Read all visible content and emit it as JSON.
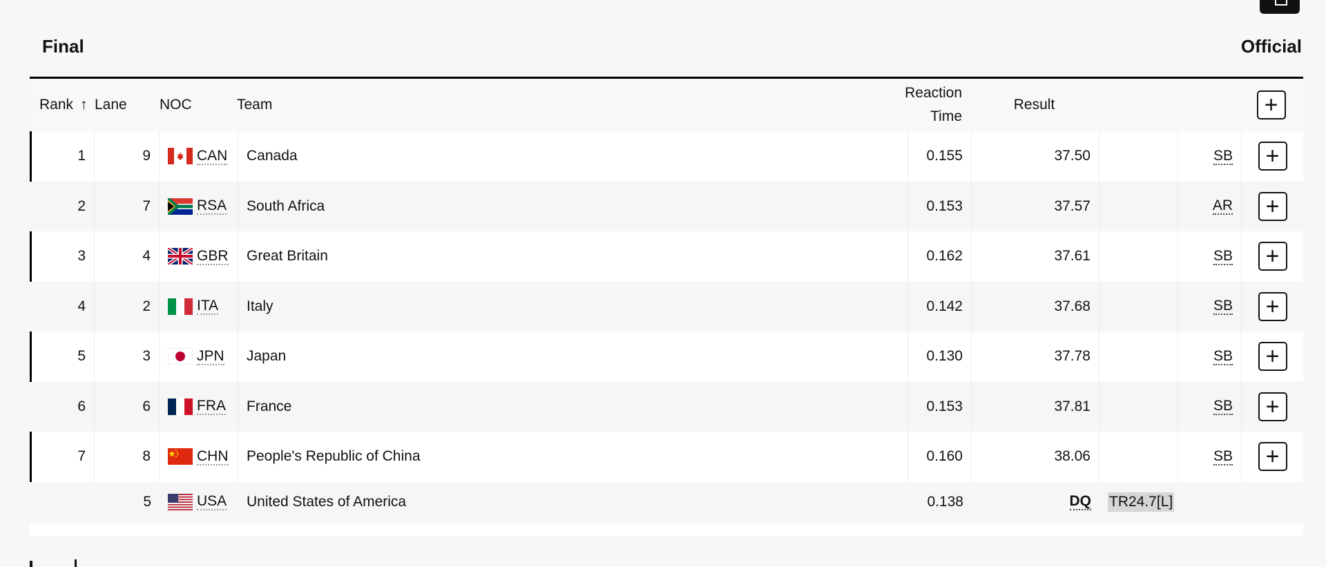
{
  "page": {
    "title": "Final",
    "status": "Official"
  },
  "table": {
    "headers": {
      "rank": "Rank",
      "rank_sort_icon": "arrow-up-icon",
      "lane": "Lane",
      "noc": "NOC",
      "team": "Team",
      "reaction_line1": "Reaction",
      "reaction_line2": "Time",
      "result": "Result",
      "expand_all_icon": "plus-icon"
    },
    "rows": [
      {
        "rank": "1",
        "lane": "9",
        "noc": "CAN",
        "team": "Canada",
        "reaction_time": "0.155",
        "result": "37.50",
        "note": "",
        "record": "SB",
        "flag": "canada"
      },
      {
        "rank": "2",
        "lane": "7",
        "noc": "RSA",
        "team": "South Africa",
        "reaction_time": "0.153",
        "result": "37.57",
        "note": "",
        "record": "AR",
        "flag": "south-africa"
      },
      {
        "rank": "3",
        "lane": "4",
        "noc": "GBR",
        "team": "Great Britain",
        "reaction_time": "0.162",
        "result": "37.61",
        "note": "",
        "record": "SB",
        "flag": "great-britain"
      },
      {
        "rank": "4",
        "lane": "2",
        "noc": "ITA",
        "team": "Italy",
        "reaction_time": "0.142",
        "result": "37.68",
        "note": "",
        "record": "SB",
        "flag": "italy"
      },
      {
        "rank": "5",
        "lane": "3",
        "noc": "JPN",
        "team": "Japan",
        "reaction_time": "0.130",
        "result": "37.78",
        "note": "",
        "record": "SB",
        "flag": "japan"
      },
      {
        "rank": "6",
        "lane": "6",
        "noc": "FRA",
        "team": "France",
        "reaction_time": "0.153",
        "result": "37.81",
        "note": "",
        "record": "SB",
        "flag": "france"
      },
      {
        "rank": "7",
        "lane": "8",
        "noc": "CHN",
        "team": "People's Republic of China",
        "reaction_time": "0.160",
        "result": "38.06",
        "note": "",
        "record": "SB",
        "flag": "china"
      }
    ],
    "dq_row": {
      "rank": "",
      "lane": "5",
      "noc": "USA",
      "team": "United States of America",
      "reaction_time": "0.138",
      "result": "DQ",
      "note": "TR24.7[L]",
      "flag": "usa"
    }
  }
}
